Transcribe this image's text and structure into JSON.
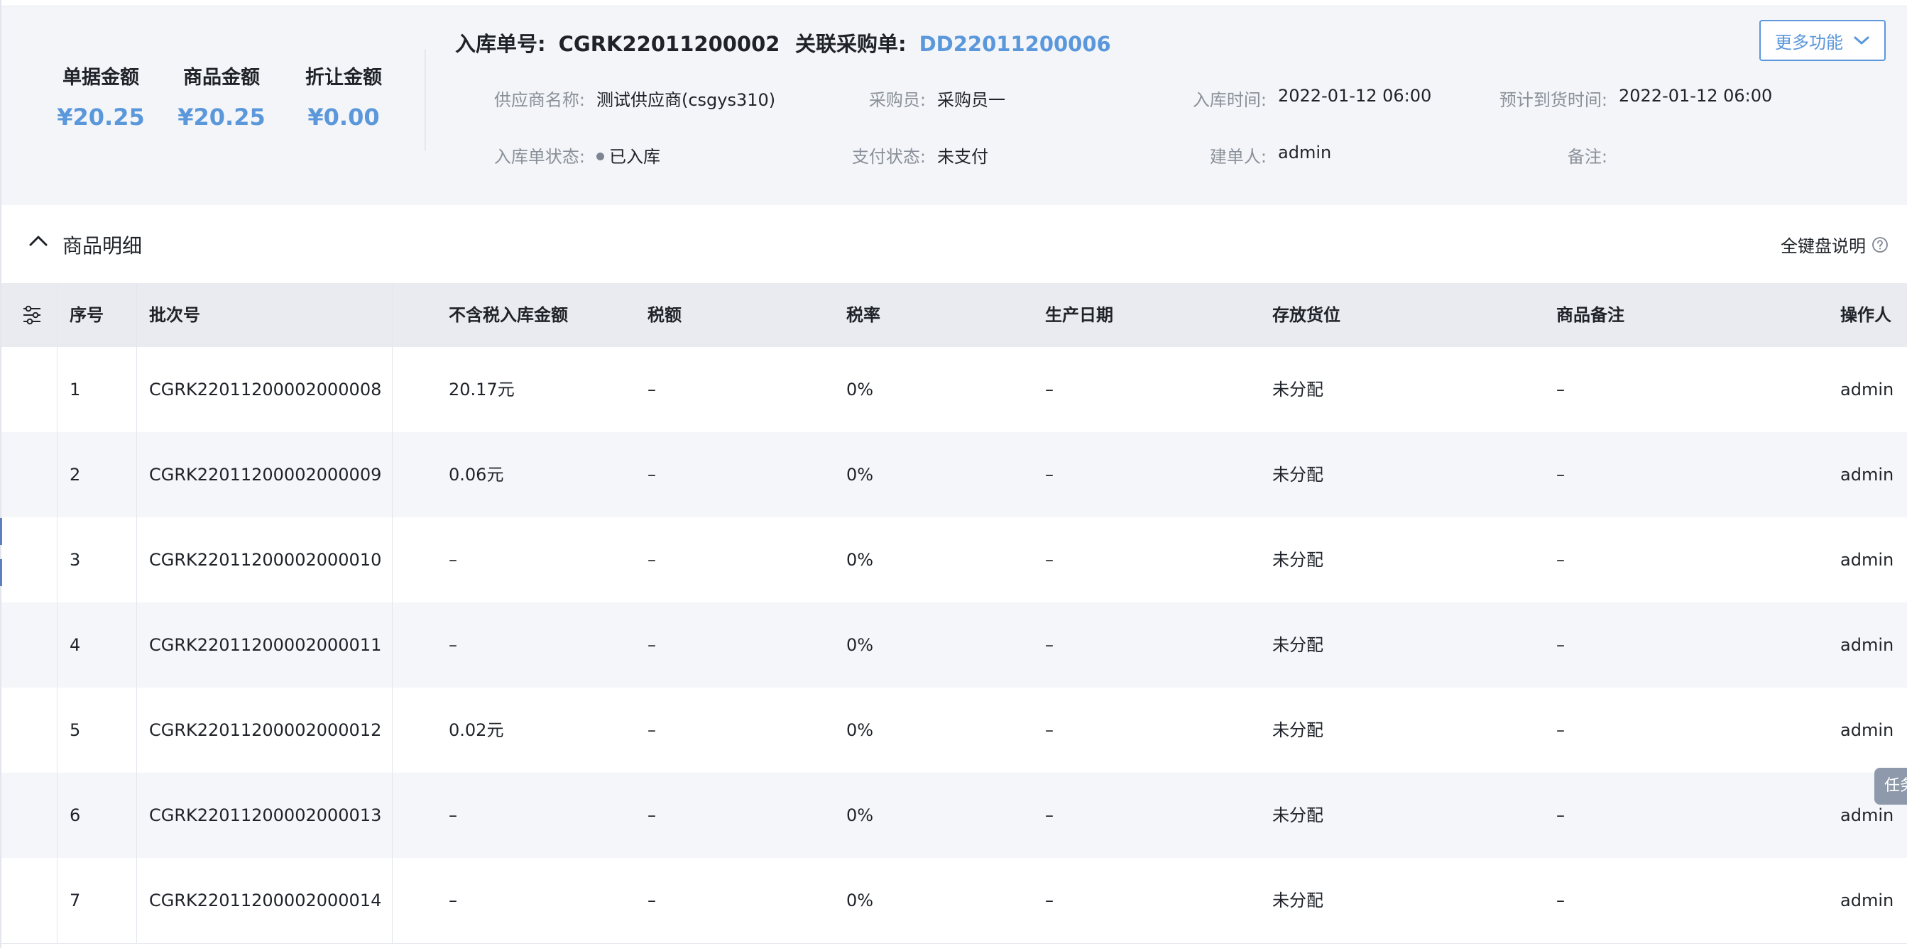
{
  "summary": {
    "doc_amount_label": "单据金额",
    "doc_amount": "¥20.25",
    "goods_amount_label": "商品金额",
    "goods_amount": "¥20.25",
    "discount_label": "折让金额",
    "discount": "¥0.00"
  },
  "header": {
    "receipt_no_label": "入库单号:",
    "receipt_no": "CGRK22011200002",
    "related_po_label": "关联采购单:",
    "related_po": "DD22011200006",
    "more_button": "更多功能",
    "fields": {
      "supplier_label": "供应商名称:",
      "supplier": "测试供应商(csgys310)",
      "buyer_label": "采购员:",
      "buyer": "采购员一",
      "in_time_label": "入库时间:",
      "in_time": "2022-01-12 06:00",
      "eta_label": "预计到货时间:",
      "eta": "2022-01-12 06:00",
      "status_label": "入库单状态:",
      "status": "已入库",
      "pay_label": "支付状态:",
      "pay": "未支付",
      "creator_label": "建单人:",
      "creator": "admin",
      "remark_label": "备注:",
      "remark": ""
    }
  },
  "section": {
    "title": "商品明细",
    "keyboard_help": "全键盘说明"
  },
  "table": {
    "columns": [
      "序号",
      "批次号",
      "不含税入库金额",
      "税额",
      "税率",
      "生产日期",
      "存放货位",
      "商品备注",
      "操作人"
    ],
    "rows": [
      [
        "1",
        "CGRK22011200002000008",
        "20.17元",
        "–",
        "0%",
        "–",
        "未分配",
        "–",
        "admin"
      ],
      [
        "2",
        "CGRK22011200002000009",
        "0.06元",
        "–",
        "0%",
        "–",
        "未分配",
        "–",
        "admin"
      ],
      [
        "3",
        "CGRK22011200002000010",
        "–",
        "–",
        "0%",
        "–",
        "未分配",
        "–",
        "admin"
      ],
      [
        "4",
        "CGRK22011200002000011",
        "–",
        "–",
        "0%",
        "–",
        "未分配",
        "–",
        "admin"
      ],
      [
        "5",
        "CGRK22011200002000012",
        "0.02元",
        "–",
        "0%",
        "–",
        "未分配",
        "–",
        "admin"
      ],
      [
        "6",
        "CGRK22011200002000013",
        "–",
        "–",
        "0%",
        "–",
        "未分配",
        "–",
        "admin"
      ],
      [
        "7",
        "CGRK22011200002000014",
        "–",
        "–",
        "0%",
        "–",
        "未分配",
        "–",
        "admin"
      ]
    ]
  },
  "task_tab": "任务",
  "colors": {
    "accent": "#5a97db",
    "header_bg": "#f3f5f8",
    "table_head_bg": "#e9ebf0",
    "row_alt_bg": "#f5f6f9"
  },
  "icons": {
    "more": "chevron-down-icon",
    "collapse": "chevron-up-icon",
    "help": "question-circle-icon",
    "columns": "sliders-icon"
  }
}
